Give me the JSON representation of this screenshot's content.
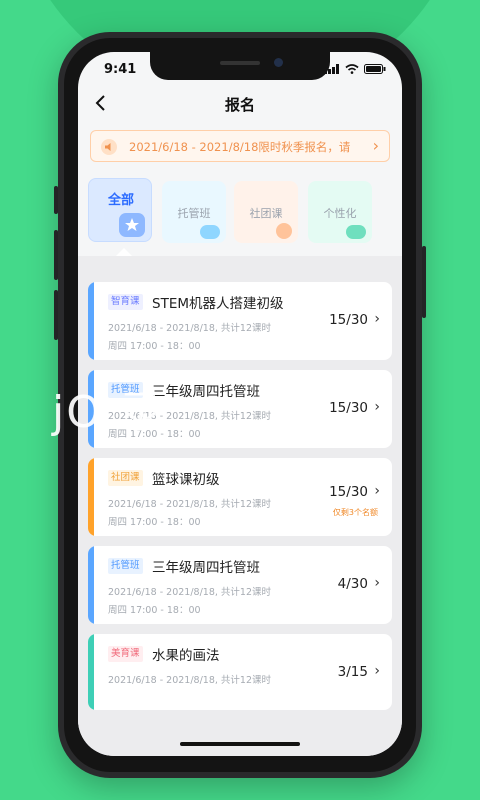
{
  "status_bar": {
    "time": "9:41"
  },
  "header": {
    "title": "报名"
  },
  "notice": {
    "text": "2021/6/18 - 2021/8/18限时秋季报名，请"
  },
  "categories": [
    {
      "label": "全部",
      "active": true
    },
    {
      "label": "托管班",
      "active": false
    },
    {
      "label": "社团课",
      "active": false
    },
    {
      "label": "个性化",
      "active": false
    }
  ],
  "courses": [
    {
      "tag": "智育课",
      "title": "STEM机器人搭建初级",
      "date": "2021/6/18 - 2021/8/18, 共计12课时",
      "time": "周四 17:00 - 18：00",
      "count": "15/30",
      "remain": "",
      "bar_color": "#5aa6ff",
      "tag_color": "#6a7bff",
      "tag_bg": "#eef0ff"
    },
    {
      "tag": "托管班",
      "title": "三年级周四托管班",
      "date": "2021/6/18 - 2021/8/18, 共计12课时",
      "time": "周四 17:00 - 18：00",
      "count": "15/30",
      "remain": "",
      "bar_color": "#5aa6ff",
      "tag_color": "#4b96ff",
      "tag_bg": "#e8f2ff"
    },
    {
      "tag": "社团课",
      "title": "篮球课初级",
      "date": "2021/6/18 - 2021/8/18, 共计12课时",
      "time": "周四 17:00 - 18：00",
      "count": "15/30",
      "remain": "仅剩3个名额",
      "bar_color": "#ffa22a",
      "tag_color": "#f0a23a",
      "tag_bg": "#fff4e2"
    },
    {
      "tag": "托管班",
      "title": "三年级周四托管班",
      "date": "2021/6/18 - 2021/8/18, 共计12课时",
      "time": "周四 17:00 - 18：00",
      "count": "4/30",
      "remain": "",
      "bar_color": "#5aa6ff",
      "tag_color": "#4b96ff",
      "tag_bg": "#e8f2ff"
    },
    {
      "tag": "美育课",
      "title": "水果的画法",
      "date": "2021/6/18 - 2021/8/18, 共计12课时",
      "time": "",
      "count": "3/15",
      "remain": "",
      "bar_color": "#3ecfb6",
      "tag_color": "#f06a7a",
      "tag_bg": "#ffeef0"
    }
  ],
  "watermark": {
    "text": "jO       录"
  },
  "colors": {
    "background": "#44d98a",
    "accent": "#2c6cff"
  }
}
